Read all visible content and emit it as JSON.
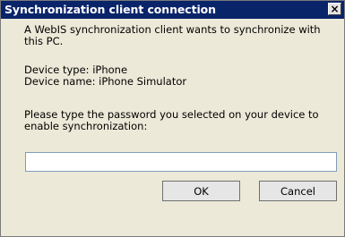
{
  "dialog": {
    "title": "Synchronization client connection",
    "close_symbol": "×",
    "close_icon": "close-icon",
    "intro": "A WebIS synchronization client wants to synchronize with this PC.",
    "device_type": "Device type: iPhone",
    "device_name": "Device name: iPhone Simulator",
    "prompt": "Please type the password you selected on your device to enable synchronization:",
    "password_value": "",
    "ok_label": "OK",
    "cancel_label": "Cancel"
  },
  "colors": {
    "titlebar": "#0a246a",
    "titlebar_text": "#ffffff",
    "dialog_background": "#ece9d8",
    "input_border": "#7f9db9"
  }
}
